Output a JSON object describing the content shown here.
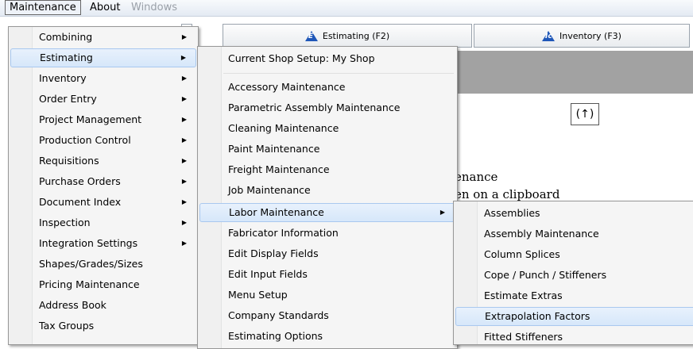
{
  "menubar": {
    "items": [
      {
        "label": "Maintenance",
        "open": true
      },
      {
        "label": "About",
        "open": false
      },
      {
        "label": "Windows",
        "disabled": true
      }
    ]
  },
  "toolbar": {
    "tabs": [
      {
        "label": "Estimating (F2)",
        "icon_letter": "E"
      },
      {
        "label": "Inventory (F3)",
        "icon_letter": "Ic"
      }
    ]
  },
  "content": {
    "up_button": "(↑)",
    "line1": "enance",
    "line2": "en on a clipboard"
  },
  "menu_main": {
    "items": [
      {
        "label": "Combining",
        "submenu": true
      },
      {
        "label": "Estimating",
        "submenu": true,
        "highlighted": true
      },
      {
        "label": "Inventory",
        "submenu": true
      },
      {
        "label": "Order Entry",
        "submenu": true
      },
      {
        "label": "Project Management",
        "submenu": true
      },
      {
        "label": "Production Control",
        "submenu": true
      },
      {
        "label": "Requisitions",
        "submenu": true
      },
      {
        "label": "Purchase Orders",
        "submenu": true
      },
      {
        "label": "Document Index",
        "submenu": true
      },
      {
        "label": "Inspection",
        "submenu": true
      },
      {
        "label": "Integration Settings",
        "submenu": true
      },
      {
        "label": "Shapes/Grades/Sizes",
        "submenu": false
      },
      {
        "label": "Pricing Maintenance",
        "submenu": false
      },
      {
        "label": "Address Book",
        "submenu": false
      },
      {
        "label": "Tax Groups",
        "submenu": false
      }
    ]
  },
  "menu_estimating": {
    "header_item": "Current Shop Setup: My Shop",
    "items": [
      {
        "label": "Accessory Maintenance"
      },
      {
        "label": "Parametric Assembly Maintenance"
      },
      {
        "label": "Cleaning Maintenance"
      },
      {
        "label": "Paint Maintenance"
      },
      {
        "label": "Freight Maintenance"
      },
      {
        "label": "Job Maintenance"
      },
      {
        "label": "Labor Maintenance",
        "submenu": true,
        "highlighted": true
      },
      {
        "label": "Fabricator Information"
      },
      {
        "label": "Edit Display Fields"
      },
      {
        "label": "Edit Input Fields"
      },
      {
        "label": "Menu Setup"
      },
      {
        "label": "Company Standards"
      },
      {
        "label": "Estimating Options"
      }
    ]
  },
  "menu_labor": {
    "items": [
      {
        "label": "Assemblies"
      },
      {
        "label": "Assembly Maintenance"
      },
      {
        "label": "Column Splices"
      },
      {
        "label": "Cope / Punch / Stiffeners"
      },
      {
        "label": "Estimate Extras"
      },
      {
        "label": "Extrapolation Factors",
        "highlighted": true
      },
      {
        "label": "Fitted Stiffeners"
      }
    ]
  }
}
